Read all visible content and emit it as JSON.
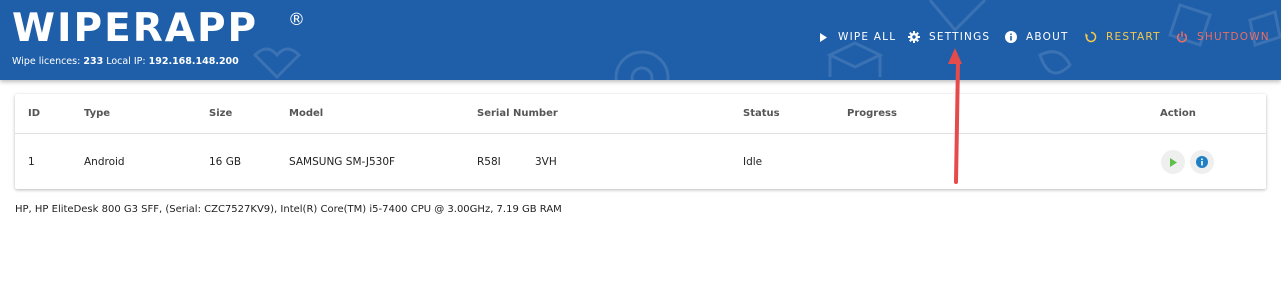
{
  "app": {
    "logo": "WIPERAPP",
    "registered_mark": "®",
    "licences_label": "Wipe licences:",
    "licences_count": "233",
    "ip_label": "Local IP:",
    "ip_value": "192.168.148.200"
  },
  "nav": {
    "wipe_all": "WIPE ALL",
    "settings": "SETTINGS",
    "about": "ABOUT",
    "restart": "RESTART",
    "shutdown": "SHUTDOWN"
  },
  "table": {
    "headers": [
      "ID",
      "Type",
      "Size",
      "Model",
      "Serial Number",
      "Status",
      "Progress",
      "Action"
    ],
    "rows": [
      {
        "id": "1",
        "type": "Android",
        "size": "16 GB",
        "model": "SAMSUNG SM-J530F",
        "serial_start": "R58I",
        "serial_end": "3VH",
        "status": "Idle",
        "progress": ""
      }
    ]
  },
  "system_info": "HP, HP EliteDesk 800 G3 SFF, (Serial: CZC7527KV9), Intel(R) Core(TM) i5-7400 CPU @ 3.00GHz, 7.19 GB RAM",
  "colors": {
    "header_bg": "#1f5fa9",
    "restart": "#f6c94a",
    "shutdown": "#ec6d63",
    "play": "#5cc04a",
    "info": "#1f7fc4",
    "annotation_arrow": "#e64b4b"
  },
  "icons": {
    "wipe_all": "play-icon",
    "settings": "gear-icon",
    "about": "info-icon",
    "restart": "restart-icon",
    "shutdown": "power-icon",
    "row_start": "play-icon",
    "row_info": "info-icon"
  }
}
